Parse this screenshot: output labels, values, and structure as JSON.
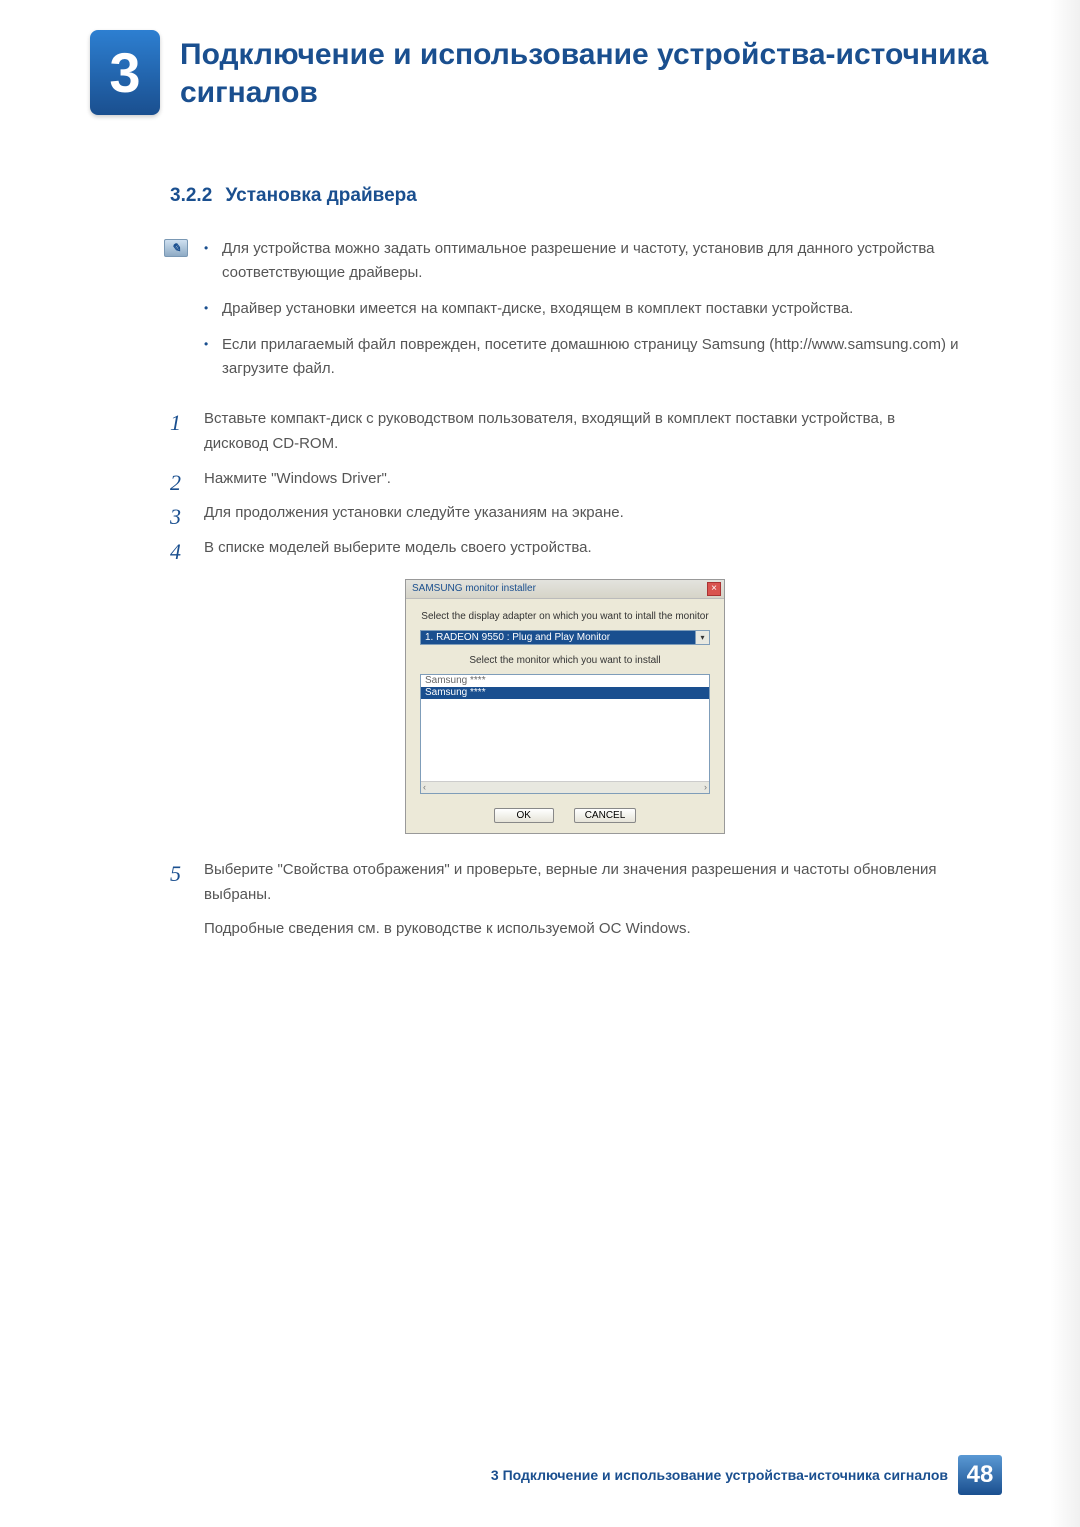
{
  "chapter": {
    "number": "3",
    "title": "Подключение и использование устройства-источника сигналов"
  },
  "section": {
    "number": "3.2.2",
    "title": "Установка драйвера"
  },
  "notes": [
    "Для устройства можно задать оптимальное разрешение и частоту, установив для данного устройства соответствующие драйверы.",
    "Драйвер установки имеется на компакт-диске, входящем в комплект поставки устройства.",
    "Если прилагаемый файл поврежден, посетите домашнюю страницу Samsung (http://www.samsung.com) и загрузите файл."
  ],
  "steps": [
    {
      "n": "1",
      "text": "Вставьте компакт-диск с руководством пользователя, входящий в комплект поставки устройства, в дисковод CD-ROM."
    },
    {
      "n": "2",
      "text": "Нажмите \"Windows Driver\"."
    },
    {
      "n": "3",
      "text": "Для продолжения установки следуйте указаниям на экране."
    },
    {
      "n": "4",
      "text": "В списке моделей выберите модель своего устройства."
    },
    {
      "n": "5",
      "text": "Выберите \"Свойства отображения\" и проверьте, верные ли значения разрешения и частоты обновления выбраны."
    }
  ],
  "step5_extra": "Подробные сведения см. в руководстве к используемой ОС Windows.",
  "dialog": {
    "title": "SAMSUNG monitor installer",
    "label1": "Select the display adapter on which you want to intall the monitor",
    "adapter": "1. RADEON 9550 : Plug and Play Monitor",
    "label2": "Select the monitor which you want to install",
    "items": [
      "Samsung ****",
      "Samsung ****"
    ],
    "ok": "OK",
    "cancel": "CANCEL"
  },
  "footer": {
    "text": "3 Подключение и использование устройства-источника сигналов",
    "page": "48"
  }
}
